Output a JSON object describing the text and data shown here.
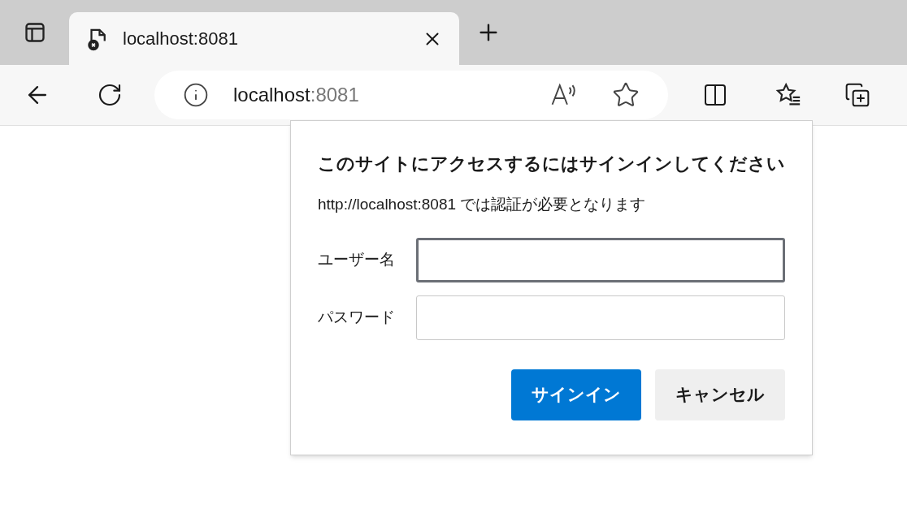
{
  "tab": {
    "title": "localhost:8081",
    "selected": true
  },
  "address": {
    "host": "localhost",
    "port": ":8081"
  },
  "dialog": {
    "title": "このサイトにアクセスするにはサインインしてください",
    "message": "http://localhost:8081 では認証が必要となります",
    "fields": [
      {
        "label": "ユーザー名",
        "focused": true
      },
      {
        "label": "パスワード",
        "focused": false
      }
    ],
    "buttons": [
      {
        "label": "サインイン",
        "kind": "primary"
      },
      {
        "label": "キャンセル",
        "kind": "secondary"
      }
    ]
  }
}
